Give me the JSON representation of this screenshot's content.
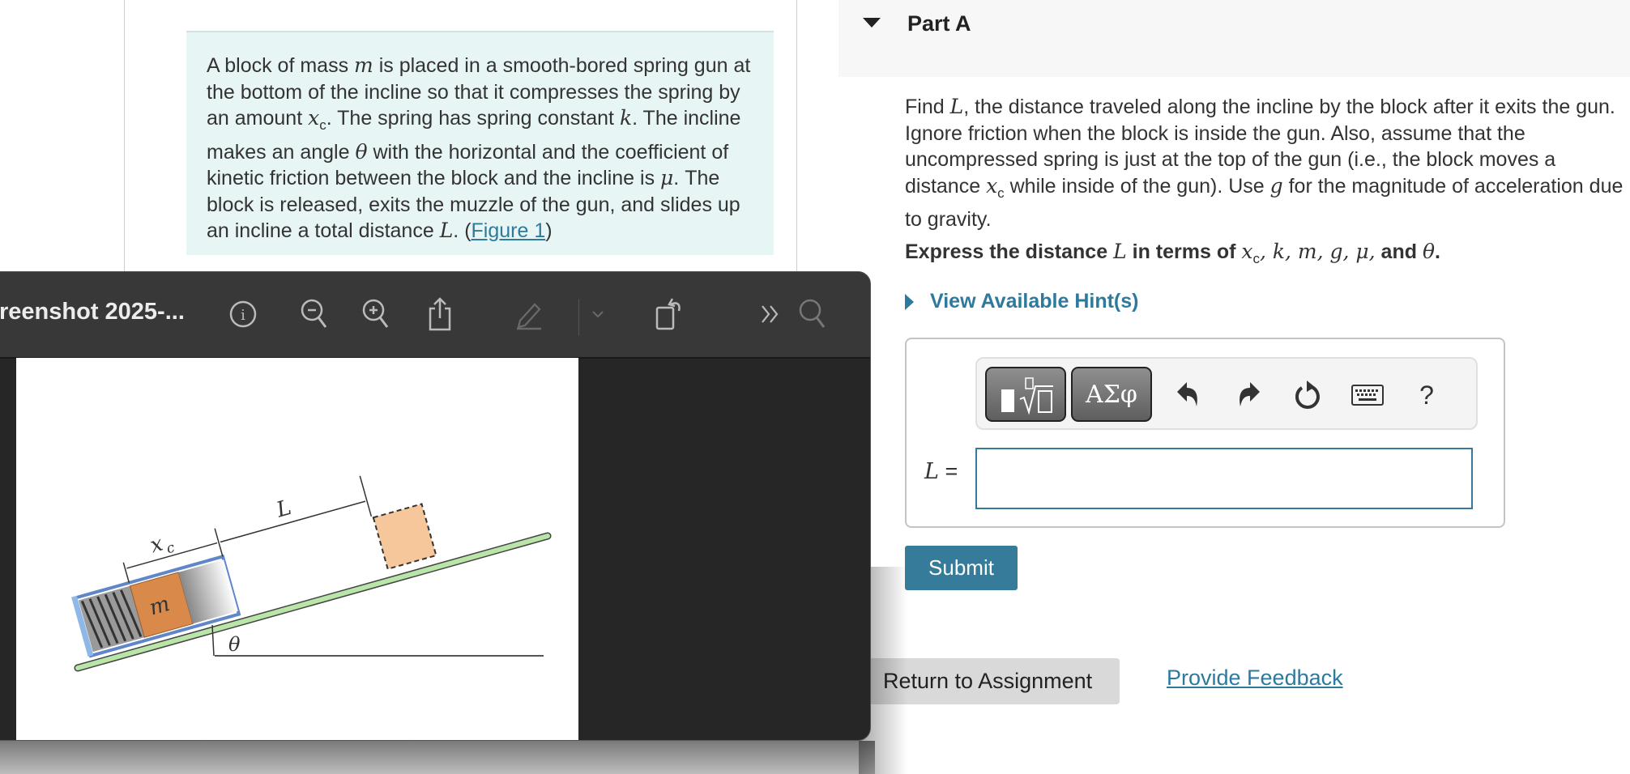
{
  "problem": {
    "text_parts": {
      "p1": "A block of mass ",
      "m": "m",
      "p2": " is placed in a smooth-bored spring gun at the bottom of the incline so that it compresses the spring by an amount ",
      "xc": "x",
      "xc_sub": "c",
      "p3": ". The spring has spring constant ",
      "k": "k",
      "p4": ". The incline makes an angle ",
      "theta": "θ",
      "p5": " with the horizontal and the coefficient of kinetic friction between the block and the incline is ",
      "mu": "μ",
      "p6": ". The block is released, exits the muzzle of the gun, and slides up an incline a total distance ",
      "L": "L",
      "p7": ". (",
      "figure_link": "Figure 1",
      "p8": ")"
    }
  },
  "preview_window": {
    "title": "reenshot 2025-...",
    "toolbar_icons": [
      "info-icon",
      "zoom-out-icon",
      "zoom-in-icon",
      "share-icon",
      "markup-pen-icon",
      "markup-dropdown-icon",
      "rotate-icon",
      "more-icon",
      "search-icon"
    ],
    "figure": {
      "labels": {
        "xc": "x",
        "xc_sub": "c",
        "L": "L",
        "m": "m",
        "theta": "θ"
      },
      "colors": {
        "incline": "#b9e6a8",
        "block": "#d98a4a",
        "ghost_block": "#f6c79a",
        "gun": "#8fb8e8"
      }
    }
  },
  "partA": {
    "title": "Part A",
    "question": {
      "q1": "Find ",
      "L": "L",
      "q2": ", the distance traveled along the incline by the block after it exits the gun. Ignore friction when the block is inside the gun. Also, assume that the uncompressed spring is just at the top of the gun (i.e., the block moves a distance ",
      "xc": "x",
      "xc_sub": "c",
      "q3": " while inside of the gun). Use ",
      "g": "g",
      "q4": " for the magnitude of acceleration due to gravity."
    },
    "express": {
      "e1": "Express the distance ",
      "L": "L",
      "e2": " in terms of ",
      "vars": "x",
      "vars_sub": "c",
      "vars_rest": ", k, m, g, μ,",
      "e3": " and ",
      "theta": "θ",
      "e4": "."
    },
    "hint_label": "View Available Hint(s)",
    "toolbar": {
      "templates_label": "templates",
      "greek_label": "ΑΣφ",
      "help_label": "?"
    },
    "answer_label_var": "L",
    "answer_label_eq": " =",
    "answer_value": "",
    "submit_label": "Submit"
  },
  "footer": {
    "return_label": "Return to Assignment",
    "feedback_label": "Provide Feedback"
  },
  "colors": {
    "accent": "#377b9b",
    "link": "#2d7a9c",
    "problem_bg": "#e8f5f5"
  }
}
